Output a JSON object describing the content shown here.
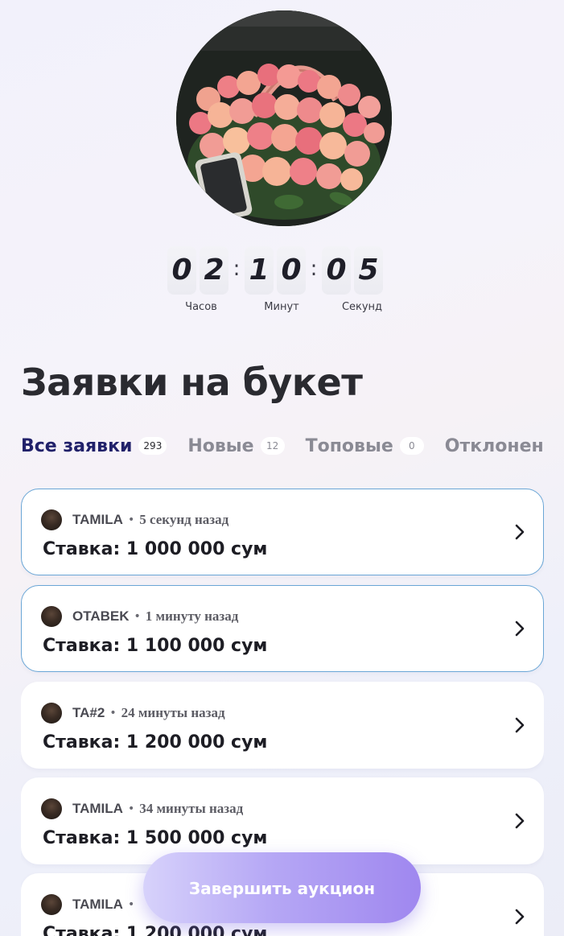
{
  "timer": {
    "digits": [
      "0",
      "2",
      "1",
      "0",
      "0",
      "5"
    ],
    "separator": ":",
    "labels": {
      "hours": "Часов",
      "minutes": "Минут",
      "seconds": "Секунд"
    }
  },
  "page_title": "Заявки на букет",
  "tabs": [
    {
      "label": "Все заявки",
      "count": "293",
      "active": true
    },
    {
      "label": "Новые",
      "count": "12",
      "active": false
    },
    {
      "label": "Топовые",
      "count": "0",
      "active": false
    },
    {
      "label": "Отклонен",
      "count": "",
      "active": false
    }
  ],
  "bids": [
    {
      "name": "TAMILA",
      "separator": "•",
      "time": "5 секунд назад",
      "amount": "Ставка: 1 000 000 сум",
      "highlight": true
    },
    {
      "name": "OTABEK",
      "separator": "•",
      "time": "1 минуту назад",
      "amount": "Ставка: 1 100 000 сум",
      "highlight": true
    },
    {
      "name": "TA#2",
      "separator": "•",
      "time": "24 минуты назад",
      "amount": "Ставка: 1 200 000 сум",
      "highlight": false
    },
    {
      "name": "TAMILA",
      "separator": "•",
      "time": "34 минуты назад",
      "amount": "Ставка: 1 500 000 сум",
      "highlight": false
    },
    {
      "name": "TAMILA",
      "separator": "•",
      "time": "",
      "amount": "Ставка: 1 200 000 сум",
      "highlight": false
    }
  ],
  "actions": {
    "finish_label": "Завершить аукцион"
  },
  "colors": {
    "accent": "#21216a",
    "highlight_border": "#6aa6d6",
    "button_gradient_start": "#d7d2fb",
    "button_gradient_end": "#9f87ef"
  },
  "icons": {
    "card_arrow": "chevron-right-icon"
  }
}
